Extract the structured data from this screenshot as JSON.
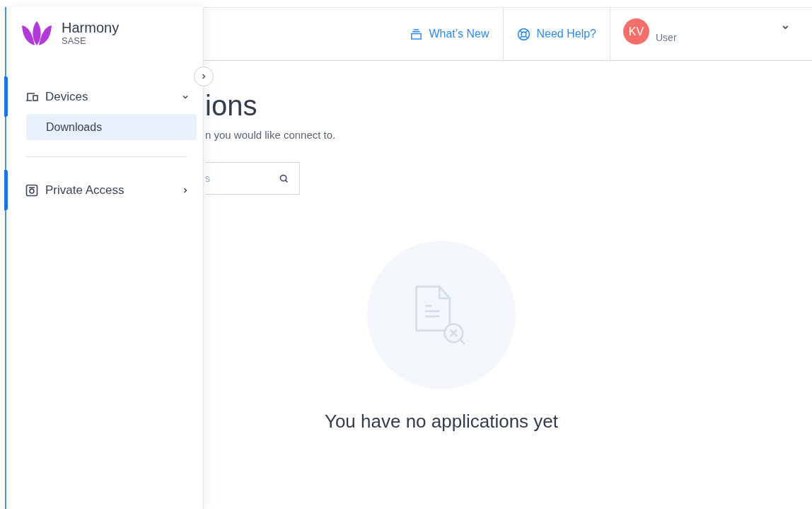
{
  "brand": {
    "name": "Harmony",
    "product": "SASE"
  },
  "sidebar": {
    "items": [
      {
        "label": "Devices",
        "kind": "devices",
        "expanded": true,
        "active": true,
        "children": [
          {
            "label": "Downloads",
            "selected": true
          }
        ]
      },
      {
        "label": "Private Access",
        "kind": "access",
        "expanded": false,
        "active": true
      }
    ]
  },
  "header": {
    "links": [
      {
        "label": "What’s New",
        "kind": "news"
      },
      {
        "label": "Need Help?",
        "kind": "help"
      }
    ],
    "user": {
      "initials": "KV",
      "role": "User"
    }
  },
  "page": {
    "title": "ions",
    "subtitle": "n you would like connect to.",
    "search": {
      "placeholder": "s"
    },
    "empty_message": "You have no applications yet"
  }
}
